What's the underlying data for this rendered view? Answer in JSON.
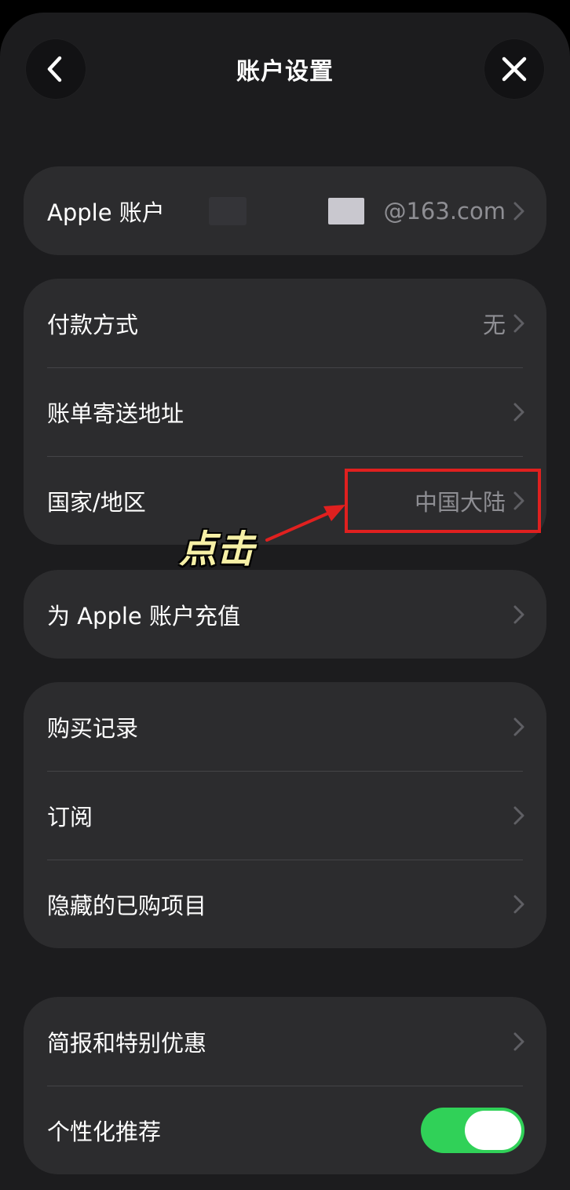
{
  "header": {
    "title": "账户设置",
    "back_icon": "chevron-left-icon",
    "close_icon": "close-icon"
  },
  "account": {
    "label": "Apple 账户",
    "email_suffix": "@163.com"
  },
  "payment_group": {
    "payment_method": {
      "label": "付款方式",
      "value": "无"
    },
    "billing_address": {
      "label": "账单寄送地址"
    },
    "country_region": {
      "label": "国家/地区",
      "value": "中国大陆"
    }
  },
  "annotation": {
    "text": "点击",
    "highlight_color": "#e0201f"
  },
  "top_up": {
    "label": "为 Apple 账户充值"
  },
  "purchases_group": {
    "purchase_history": {
      "label": "购买记录"
    },
    "subscriptions": {
      "label": "订阅"
    },
    "hidden_purchases": {
      "label": "隐藏的已购项目"
    }
  },
  "offers_group": {
    "newsletters": {
      "label": "简报和特别优惠"
    },
    "personalized_recommendations": {
      "label": "个性化推荐",
      "enabled": true
    }
  },
  "colors": {
    "background": "#1c1c1e",
    "card": "#2c2c2e",
    "secondary_text": "#8e8e93",
    "toggle_on": "#30d158"
  }
}
